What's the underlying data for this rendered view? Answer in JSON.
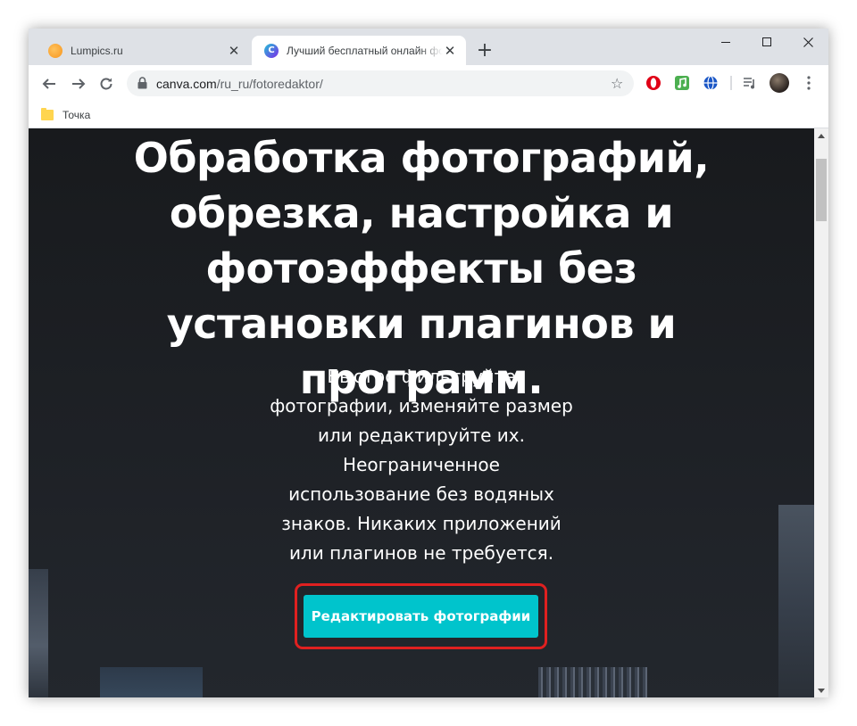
{
  "browser": {
    "tabs": [
      {
        "title": "Lumpics.ru",
        "icon": "lumpics-orange-icon",
        "active": false
      },
      {
        "title": "Лучший бесплатный онлайн фо",
        "icon": "canva-icon",
        "active": true
      }
    ],
    "new_tab_label": "+",
    "url_host": "canva.com",
    "url_path": "/ru_ru/fotoredaktor/",
    "bookmarks": [
      {
        "label": "Точка",
        "icon": "folder-icon"
      }
    ],
    "extensions": [
      "opera-icon",
      "music-icon",
      "vpn-globe-icon",
      "media-control-icon",
      "profile-avatar",
      "menu-icon"
    ]
  },
  "page": {
    "headline": "Обработка фотографий, обрезка, настройка и фотоэффекты без установки плагинов и программ.",
    "subtext": "Быстро фильтруйте фотографии, изменяйте размер или редактируйте их. Неограниченное использование без водяных знаков. Никаких приложений или плагинов не требуется.",
    "cta_label": "Редактировать фотографии"
  },
  "colors": {
    "cta_background": "#00c4cc",
    "highlight_border": "#e02020",
    "page_background": "#1c1f24"
  }
}
